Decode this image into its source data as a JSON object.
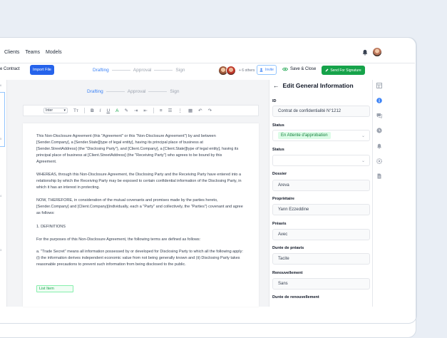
{
  "nav": {
    "links": [
      "Clients",
      "Teams",
      "Models"
    ],
    "bell_icon": "bell-icon"
  },
  "toolbar": {
    "contract_label": "e Contract",
    "import_label": "Import File",
    "steps": [
      {
        "label": "Drafting",
        "active": true
      },
      {
        "label": "Approval",
        "active": false
      },
      {
        "label": "Sign",
        "active": false
      }
    ],
    "others_label": "+ 6 others",
    "invite_label": "Invite",
    "save_label": "Save & Close",
    "sign_label": "Send For Signature"
  },
  "editor": {
    "steps": [
      {
        "label": "Drafting",
        "active": true
      },
      {
        "label": "Approval",
        "active": false
      },
      {
        "label": "Sign",
        "active": false
      }
    ],
    "font_select": "Inter",
    "ruler_marks": [
      "6",
      "5",
      "4",
      "3"
    ],
    "paragraphs": [
      "This Non-Disclosure Agreement (this \"Agreement\" or this \"Non-Disclosure Agreement\") by and between [Sender.Company], a [Sender.State][type of legal entity], having its principal place of business at [Sender.StreetAddress] (the \"Disclosing Party\"), and [Client.Company], a [Client.State][type of legal entity], having its principal place of business at [Client.StreetAddress] (the \"Receiving Party\") who agrees to be bound by this Agreement.",
      "WHEREAS, through this Non-Disclosure Agreement, the Disclosing Party and the Receiving Party have entered into a relationship by which the Receiving Party may be exposed to certain confidential information of the Disclosing Party, in which it has an interest in protecting.",
      "NOW, THEREFORE, in consideration of the mutual covenants and promises made by the parties hereto, [Sender.Company] and [Client.Company](individually, each a \"Party\" and collectively, the \"Parties\") covenant and agree as follows:",
      "1. DEFINITIONS",
      "For the purposes of this Non-Disclosure Agreement, the following terms are defined as follows:",
      "a. \"Trade Secret\" means all information possessed by or developed for Disclosing Party to which all the following apply: (i) the information derives independent economic value from not being generally known and (ii) Disclosing Party takes reasonable precautions to prevent such information from being disclosed to the public."
    ],
    "list_item": "List Item"
  },
  "panel": {
    "title": "Edit General Information",
    "fields": [
      {
        "label": "ID",
        "value": "Contrat de confidentialité N°1212",
        "type": "text"
      },
      {
        "label": "Status",
        "value": "En Attente d'approbation",
        "type": "select-tag"
      },
      {
        "label": "Status",
        "value": "",
        "type": "select"
      },
      {
        "label": "Dossier",
        "value": "Areva",
        "type": "text"
      },
      {
        "label": "Propriétaire",
        "value": "Yann Ezzeddine",
        "type": "text"
      },
      {
        "label": "Préavis",
        "value": "Avec",
        "type": "text"
      },
      {
        "label": "Durée de préavis",
        "value": "Tacite",
        "type": "text"
      },
      {
        "label": "Renouvellement",
        "value": "Sans",
        "type": "text"
      },
      {
        "label": "Durée de renouvellement",
        "value": "",
        "type": "label-only"
      }
    ]
  },
  "colors": {
    "accent": "#3b82f6",
    "primary_button": "#2563eb",
    "sign_button": "#16a34a",
    "tag_bg": "#dcfce7",
    "tag_text": "#15803d"
  }
}
